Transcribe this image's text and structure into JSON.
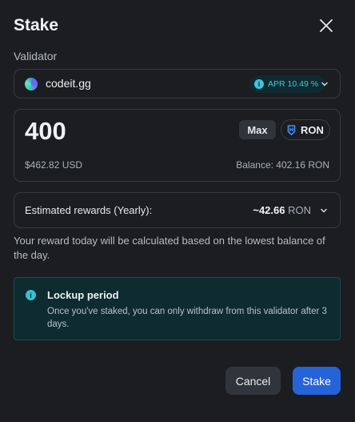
{
  "modal": {
    "title": "Stake"
  },
  "validator": {
    "label": "Validator",
    "name": "codeit.gg",
    "apr": "APR 10.49 %"
  },
  "amount": {
    "value": "400",
    "max_label": "Max",
    "token": "RON",
    "usd_value": "$462.82 USD",
    "balance": "Balance: 402.16 RON"
  },
  "rewards": {
    "label": "Estimated rewards (Yearly):",
    "amount": "~42.66",
    "unit": "RON"
  },
  "note": "Your reward today will be calculated based on the lowest balance of the day.",
  "lockup": {
    "title": "Lockup period",
    "body": "Once you've staked, you can only withdraw from this validator after 3 days."
  },
  "actions": {
    "cancel_label": "Cancel",
    "stake_label": "Stake"
  },
  "colors": {
    "background": "#1b1d21",
    "accent": "#2563d8",
    "info": "#3fc7db",
    "info_bg": "#0e2b30"
  },
  "icons": {
    "close": "close-icon",
    "info": "info-icon",
    "chevron": "chevron-down-icon",
    "ron": "ronin-token-icon"
  }
}
